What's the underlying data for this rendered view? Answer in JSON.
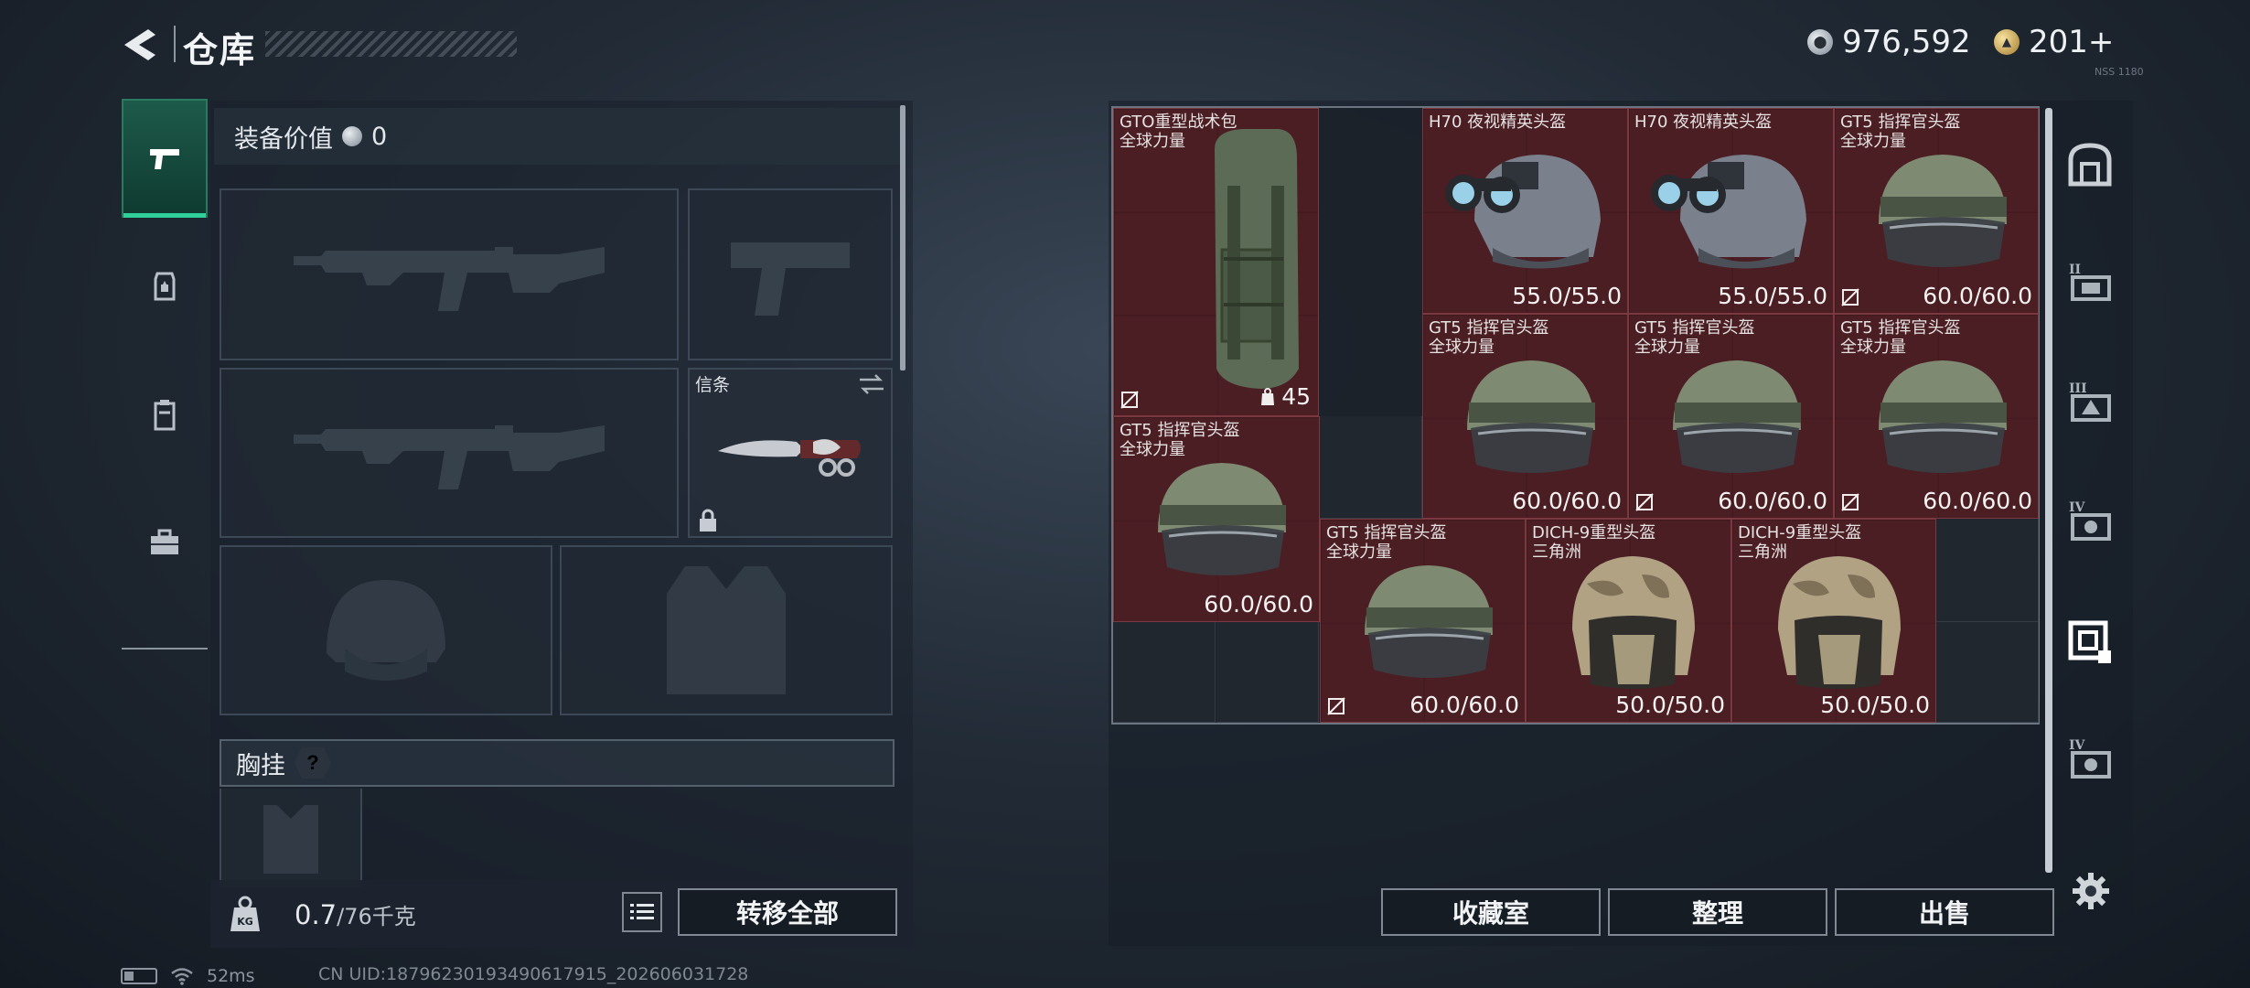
{
  "header": {
    "title": "仓库",
    "currency_silver": "976,592",
    "currency_gold": "201+",
    "currency_note": "NSS 1180"
  },
  "left_nav": {
    "items": [
      "pistol-icon",
      "backpack-icon",
      "clipboard-icon",
      "toolbox-icon"
    ],
    "active_index": 0,
    "accent_color": "#2fd09a"
  },
  "loadout": {
    "equipment_value_label": "装备价值",
    "equipment_value": "0",
    "melee_name": "信条",
    "chest_rig_label": "胸挂",
    "chest_help": "?",
    "weight_current": "0.7",
    "weight_max": "/76千克",
    "transfer_all": "转移全部"
  },
  "inventory": {
    "items": [
      {
        "name": "GTO重型战术包",
        "sub": "全球力量",
        "capacity": "45",
        "icon": "backpack-icon"
      },
      {
        "name": "H70 夜视精英头盔",
        "sub": "",
        "durability": "55.0/55.0",
        "icon": "helmet-nvg-icon"
      },
      {
        "name": "H70 夜视精英头盔",
        "sub": "",
        "durability": "55.0/55.0",
        "icon": "helmet-nvg-icon"
      },
      {
        "name": "GT5 指挥官头盔",
        "sub": "全球力量",
        "durability": "60.0/60.0",
        "icon": "helmet-visor-icon"
      },
      {
        "name": "GT5 指挥官头盔",
        "sub": "全球力量",
        "durability": "60.0/60.0",
        "icon": "helmet-visor-icon"
      },
      {
        "name": "GT5 指挥官头盔",
        "sub": "全球力量",
        "durability": "60.0/60.0",
        "icon": "helmet-visor-icon"
      },
      {
        "name": "GT5 指挥官头盔",
        "sub": "全球力量",
        "durability": "60.0/60.0",
        "icon": "helmet-visor-icon"
      },
      {
        "name": "GT5 指挥官头盔",
        "sub": "全球力量",
        "durability": "60.0/60.0",
        "icon": "helmet-visor-icon"
      },
      {
        "name": "GT5 指挥官头盔",
        "sub": "全球力量",
        "durability": "60.0/60.0",
        "icon": "helmet-visor-icon"
      },
      {
        "name": "DICH-9重型头盔",
        "sub": "三角洲",
        "durability": "50.0/50.0",
        "icon": "helmet-camo-icon"
      },
      {
        "name": "DICH-9重型头盔",
        "sub": "三角洲",
        "durability": "50.0/50.0",
        "icon": "helmet-camo-icon"
      }
    ],
    "item_bg_color": "#4b1e24"
  },
  "actions": {
    "collection": "收藏室",
    "sort": "整理",
    "sell": "出售"
  },
  "status": {
    "ping": "52ms",
    "uid": "CN UID:18796230193490617915_202606031728"
  }
}
